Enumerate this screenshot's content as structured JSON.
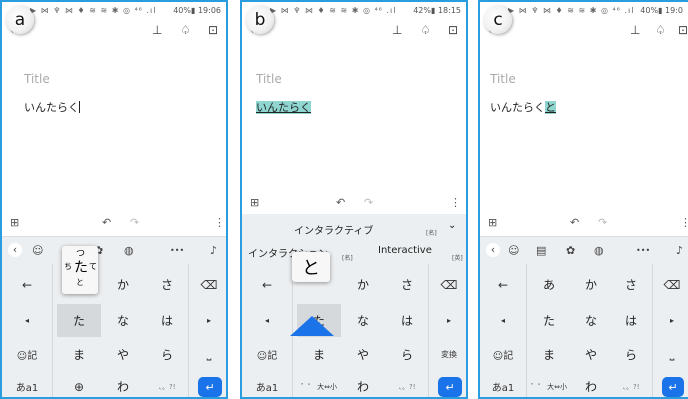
{
  "panels": [
    {
      "badge": "a",
      "status_time": "40%▮ 19:06",
      "text": "いんたらく",
      "highlight": ""
    },
    {
      "badge": "b",
      "status_time": "42%▮ 18:15",
      "text": "",
      "highlight": "いんたらく"
    },
    {
      "badge": "c",
      "status_time": "40%▮ 19:0",
      "text": "いんたらく",
      "highlight": "と"
    }
  ],
  "status_icons": "▶ ⋈ ♆ ⋈ ♦ ≋ ≋  ✱ ◎ ⁴⁶ .ıl",
  "title_placeholder": "Title",
  "toolbar": {
    "back": "←",
    "pin": "⊥",
    "bell": "♤",
    "archive": "⊡"
  },
  "editor_bar": {
    "add": "⊞",
    "undo": "↶",
    "redo": "↷",
    "more": "⋮"
  },
  "kb_toolbar": {
    "chevron": "‹",
    "sticker": "☺",
    "clipboard": "▤",
    "settings": "✿",
    "palette": "◍",
    "dots": "•••",
    "mic": "♪"
  },
  "keys": {
    "r1": [
      "←",
      "あ",
      "か",
      "さ",
      "⌫"
    ],
    "r2": [
      "◂",
      "た",
      "な",
      "は",
      "▸"
    ],
    "r3": [
      "☺記",
      "ま",
      "や",
      "ら",
      "⎵"
    ],
    "r4": [
      "あa1",
      "⊕",
      "わ",
      "、。?!",
      "↵"
    ]
  },
  "popup_a": {
    "top": "つ",
    "left": "ち",
    "center": "た",
    "right": "て",
    "bottom": "と"
  },
  "popup_b": {
    "char": "と",
    "base": "た"
  },
  "candidates_b": {
    "top": "インタラクティブ",
    "top_tag": "[名]",
    "chev": "⌄",
    "left": "インタラクション",
    "left_tag": "[名]",
    "right": "Interactive",
    "right_tag": "[英]"
  },
  "panel_b_r4_2": "゛゜ 大⇔小",
  "panel_b_r3_5": "変換"
}
